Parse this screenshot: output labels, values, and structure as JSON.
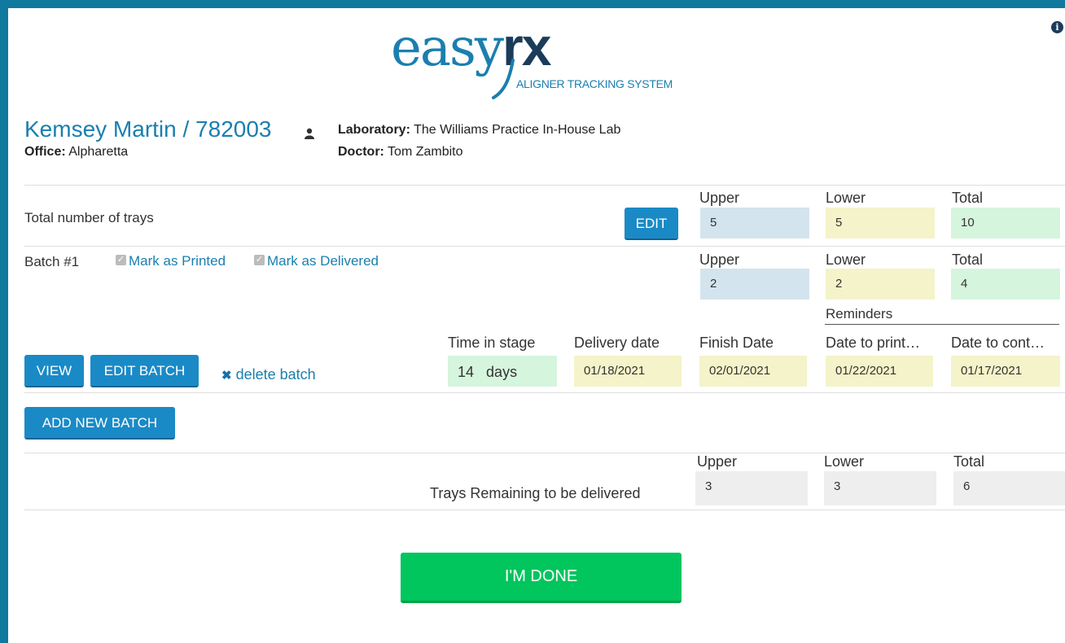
{
  "header": {
    "logo_easy": "easy",
    "logo_rx": "rx",
    "logo_subtitle": "ALIGNER TRACKING SYSTEM"
  },
  "patient": {
    "name": "Kemsey Martin / 782003",
    "office_label": "Office:",
    "office": "Alpharetta",
    "lab_label": "Laboratory:",
    "lab": "The Williams Practice In-House Lab",
    "doctor_label": "Doctor:",
    "doctor": "Tom Zambito"
  },
  "trays": {
    "label": "Total number of trays",
    "edit_label": "EDIT",
    "upper_label": "Upper",
    "lower_label": "Lower",
    "total_label": "Total",
    "upper": "5",
    "lower": "5",
    "total": "10"
  },
  "batch": {
    "title": "Batch #1",
    "mark_printed": "Mark as Printed",
    "mark_delivered": "Mark as Delivered",
    "upper_label": "Upper",
    "lower_label": "Lower",
    "total_label": "Total",
    "upper": "2",
    "lower": "2",
    "total": "4",
    "reminders_label": "Reminders",
    "time_in_stage_label": "Time in stage",
    "delivery_date_label": "Delivery date",
    "finish_date_label": "Finish Date",
    "date_to_print_label": "Date to print…",
    "date_to_contact_label": "Date to cont…",
    "time_in_stage": "14",
    "time_unit": "days",
    "delivery_date": "01/18/2021",
    "finish_date": "02/01/2021",
    "date_to_print": "01/22/2021",
    "date_to_contact": "01/17/2021",
    "view_label": "VIEW",
    "edit_batch_label": "EDIT BATCH",
    "delete_label": "delete batch"
  },
  "add_batch_label": "ADD NEW BATCH",
  "remaining": {
    "label": "Trays Remaining to be delivered",
    "upper_label": "Upper",
    "lower_label": "Lower",
    "total_label": "Total",
    "upper": "3",
    "lower": "3",
    "total": "6"
  },
  "done_label": "I'M DONE",
  "colors": {
    "frame": "#0f7a9e",
    "accent": "#1a7fae",
    "button": "#1a8ac6",
    "done": "#00c65d"
  }
}
